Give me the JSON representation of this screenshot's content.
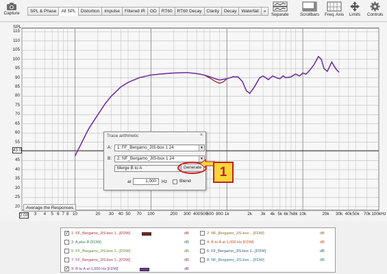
{
  "toolbar": {
    "capture_label": "Capture",
    "tabs": [
      {
        "label": "SPL & Phase",
        "active": false
      },
      {
        "label": "All SPL",
        "active": true
      },
      {
        "label": "Distortion",
        "active": false
      },
      {
        "label": "Impulse",
        "active": false
      },
      {
        "label": "Filtered IR",
        "active": false
      },
      {
        "label": "GD",
        "active": false
      },
      {
        "label": "RT60",
        "active": false
      },
      {
        "label": "RT60 Decay",
        "active": false
      },
      {
        "label": "Clarity",
        "active": false
      },
      {
        "label": "Decay",
        "active": false
      },
      {
        "label": "Waterfall",
        "active": false
      },
      {
        "label": "»",
        "active": false
      }
    ],
    "tools": [
      {
        "label": "Separate",
        "icon": "separate-icon"
      },
      {
        "label": "Scrollbars",
        "icon": "scrollbars-icon"
      },
      {
        "label": "Freq. Axis",
        "icon": "freq-axis-icon"
      },
      {
        "label": "Limits",
        "icon": "limits-icon"
      },
      {
        "label": "Controls",
        "icon": "gear-icon"
      }
    ]
  },
  "plot": {
    "y_unit": "SPL",
    "y_ticks": [
      "115",
      "110",
      "105",
      "100",
      "95",
      "90",
      "85",
      "80",
      "75",
      "70",
      "65",
      "60",
      "55",
      "50",
      "45",
      "40",
      "35",
      "30",
      "25",
      "20"
    ],
    "x_ticks": [
      "2",
      "3",
      "4",
      "5",
      "6",
      "7",
      "8",
      "10",
      "20",
      "30",
      "40",
      "50",
      "70",
      "100",
      "200",
      "300",
      "400",
      "500",
      "600",
      "800",
      "1k",
      "2k",
      "3k",
      "4k",
      "5k",
      "6k",
      "7k",
      "8k",
      "10k",
      "20k",
      "30k",
      "40k",
      "50k",
      "70k",
      "100kHz"
    ],
    "y_marker_value": "43.0",
    "x_marker_value": "2.00",
    "average_button_label": "Average the Responses",
    "colors": {
      "trace_purple": "#7030a0",
      "trace_brown": "#8b1a1a"
    }
  },
  "dialog": {
    "title": "Trace arithmetic",
    "close": "×",
    "a_label": "A:",
    "a_value": "1: FF_Bergamo_JIS-box 1 24",
    "b_label": "B:",
    "b_value": "2: NF_Bergamo_JIS-box 1 24",
    "operation": "Merge B to A",
    "generate_label": "Generate",
    "at_label": "at",
    "at_value": "1,000",
    "hz_label": "Hz",
    "blend_label": "Blend",
    "callout_number": "1"
  },
  "legend": {
    "items": [
      {
        "label": "1: FF_Bergamo_JIS-box 1...[FDW]",
        "unit": "dB",
        "checked": true,
        "swatch": "#8b1a1a",
        "text_color": "#b03030"
      },
      {
        "label": "2: NF_Bergamo_JIS-box ...[FDW]",
        "unit": "dB",
        "checked": false,
        "text_color": "#8a6a2a"
      },
      {
        "label": "3: A plus B [FDW]",
        "unit": "dB",
        "checked": false,
        "text_color": "#2a7a4a"
      },
      {
        "label": "4: B to A at 1,000 Hz [FDW]",
        "unit": "dB",
        "checked": false,
        "text_color": "#c05020"
      },
      {
        "label": "5: FF_Bergamo_JIS-box 1...[FDW]",
        "unit": "dB",
        "checked": false,
        "text_color": "#5a8a2a"
      },
      {
        "label": "6: FF_Bergamo_JIS-box 1...[FDW]",
        "unit": "dB",
        "checked": false,
        "text_color": "#2a5a8a"
      },
      {
        "label": "7: FF_Bergamo_JIS-box 1...[FDW]",
        "unit": "dB",
        "checked": false,
        "text_color": "#b03060"
      },
      {
        "label": "8: NF_Bergamo_JIS-box ...[FDW]",
        "unit": "dB",
        "checked": false,
        "text_color": "#2a7a7a"
      },
      {
        "label": "9: B to A at 1,000 Hz [FDW]",
        "unit": "dB",
        "checked": true,
        "swatch": "#7030a0",
        "text_color": "#7030a0"
      }
    ]
  }
}
